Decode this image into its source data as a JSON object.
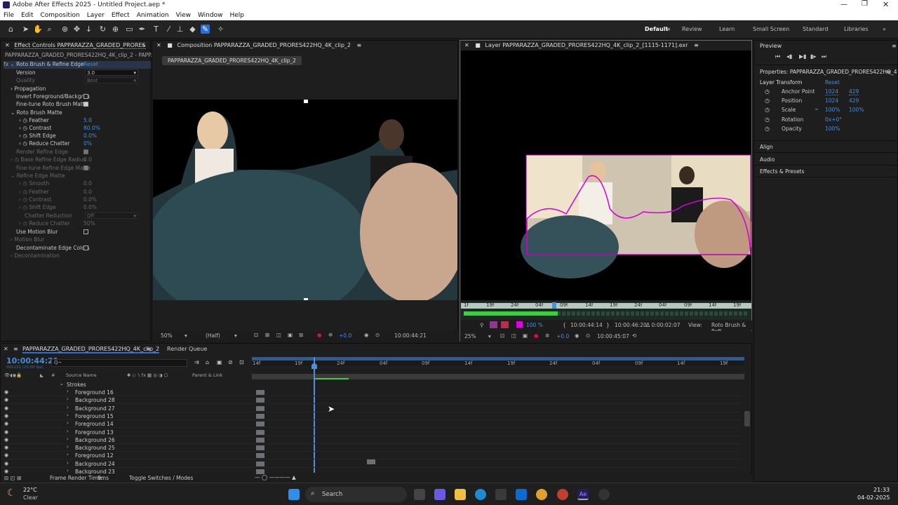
{
  "app": {
    "title": "Adobe After Effects 2025 - Untitled Project.aep *"
  },
  "menu": [
    "File",
    "Edit",
    "Composition",
    "Layer",
    "Effect",
    "Animation",
    "View",
    "Window",
    "Help"
  ],
  "workspaces": [
    "Default",
    "Review",
    "Learn",
    "Small Screen",
    "Standard",
    "Libraries"
  ],
  "effect_controls": {
    "tab": "Effect Controls PAPPARAZZA_GRADED_PRORES",
    "subtitle": "PAPPARAZZA_GRADED_PRORES422HQ_4K_clip_2 - PAPPARAZ",
    "fx_name": "Roto Brush & Refine Edge",
    "reset": "Reset",
    "version_label": "Version",
    "version_value": "3.0",
    "quality_label": "Quality",
    "quality_value": "Best",
    "propagation": "Propagation",
    "invert": "Invert Foreground/Backgrou",
    "finetune": "Fine-tune Roto Brush Matte",
    "matte_group": "Roto Brush Matte",
    "feather_l": "Feather",
    "feather_v": "5.0",
    "contrast_l": "Contrast",
    "contrast_v": "80.0%",
    "shift_l": "Shift Edge",
    "shift_v": "0.0%",
    "chatter_l": "Reduce Chatter",
    "chatter_v": "0%",
    "render_refine": "Render Refine Edge",
    "base_radius_l": "Base Refine Edge Radius",
    "base_radius_v": "0.0",
    "finetune_refine": "Fine-tune Refine Edge Matte",
    "refine_group": "Refine Edge Matte",
    "smooth_l": "Smooth",
    "smooth_v": "0.0",
    "feather2_l": "Feather",
    "feather2_v": "0.0",
    "contrast2_l": "Contrast",
    "contrast2_v": "0.0%",
    "shift2_l": "Shift Edge",
    "shift2_v": "0.0%",
    "chatterred_l": "Chatter Reduction",
    "chatterred_v": "Off",
    "chatter2_l": "Reduce Chatter",
    "chatter2_v": "50%",
    "motion_blur_use": "Use Motion Blur",
    "motion_blur": "Motion Blur",
    "decontam_use": "Decontaminate Edge Colors",
    "decontam": "Decontamination"
  },
  "composition": {
    "tab": "Composition PAPPARAZZA_GRADED_PRORES422HQ_4K_clip_2",
    "chip": "PAPPARAZZA_GRADED_PRORES422HQ_4K_clip_2",
    "zoom": "50%",
    "res": "(Half)",
    "exposure": "+0.0",
    "timecode": "10:00:44:21"
  },
  "layer": {
    "tab": "Layer PAPPARAZZA_GRADED_PRORES422HQ_4K_clip_2_[1115-1171].exr",
    "ruler": [
      "1f",
      "19f",
      "24f",
      "04f",
      "09f",
      "14f",
      "19f",
      "24f",
      "04f",
      "09f",
      "14f",
      "19f"
    ],
    "zoom_pct": "100 %",
    "tc_in": "10:00:44:14",
    "tc_out": "10:00:46:20",
    "tc_dur": "Δ 0:00:02:07",
    "view_label": "View:",
    "view_value": "Roto Brush & Refi",
    "mag": "25%",
    "exposure": "+0.0",
    "timecode": "10:00:45:07"
  },
  "preview": {
    "title": "Preview"
  },
  "properties": {
    "title": "Properties: PAPPARAZZA_GRADED_PRORES422HQ_4",
    "section": "Layer Transform",
    "reset": "Reset",
    "anchor_l": "Anchor Point",
    "anchor_x": "1024",
    "anchor_y": "429",
    "position_l": "Position",
    "position_x": "1024",
    "position_y": "429",
    "scale_l": "Scale",
    "scale_x": "100%",
    "scale_y": "100%",
    "rotation_l": "Rotation",
    "rotation_v": "0x+0°",
    "opacity_l": "Opacity",
    "opacity_v": "100%",
    "align": "Align",
    "audio": "Audio",
    "effects": "Effects & Presets"
  },
  "timeline": {
    "tab": "PAPPARAZZA_GRADED_PRORES422HQ_4K_clip_2",
    "render_queue": "Render Queue",
    "timecode": "10:00:44:21",
    "fps": "001121 (25.00 fps)",
    "search_placeholder": "Q~",
    "col_source": "Source Name",
    "col_parent": "Parent & Link",
    "strokes": "Strokes",
    "layers": [
      "Foreground 16",
      "Background 28",
      "Background 27",
      "Foreground 15",
      "Foreground 14",
      "Foreground 13",
      "Background 26",
      "Background 25",
      "Foreground 12",
      "Background 24",
      "Background 23"
    ],
    "ruler": [
      "14f",
      "19f",
      "24f",
      "04f",
      "09f",
      "14f",
      "19f",
      "24f",
      "04f",
      "09f",
      "14f",
      "19f"
    ],
    "frame_render": "Frame Render Time:",
    "frame_render_v": "9ms",
    "toggle": "Toggle Switches / Modes"
  },
  "taskbar": {
    "temp": "22°C",
    "weather": "Clear",
    "search": "Search",
    "time": "21:33",
    "date": "04-02-2025"
  }
}
